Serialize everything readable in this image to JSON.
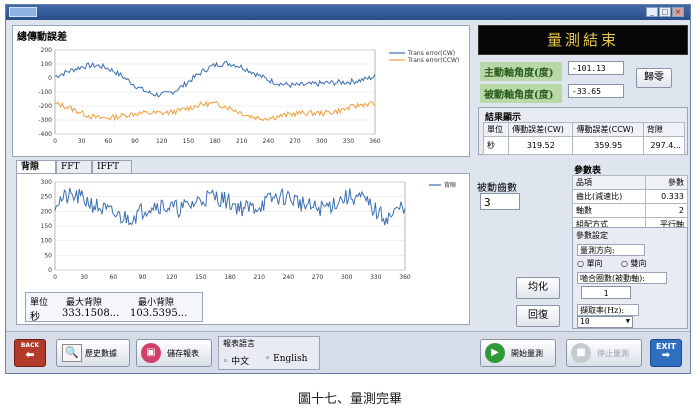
{
  "window": {
    "min": "_",
    "max": "□",
    "close": "×"
  },
  "top_chart": {
    "title": "總傳動誤差",
    "legend": [
      "Trans error(CW)",
      "Trans error(CCW)"
    ],
    "yticks": [
      "200",
      "100",
      "0",
      "-100",
      "-200",
      "-300",
      "-400"
    ],
    "xticks": [
      "0",
      "30",
      "60",
      "90",
      "120",
      "150",
      "180",
      "210",
      "240",
      "270",
      "300",
      "330",
      "360"
    ]
  },
  "result_header": "量測結束",
  "driving_angle": {
    "label": "主動軸角度(度)",
    "value": "-101.13"
  },
  "driven_angle": {
    "label": "被動軸角度(度)",
    "value": "-33.65"
  },
  "reset_button": "歸零",
  "results": {
    "title": "結果顯示",
    "headers": [
      "單位",
      "傳動誤差(CW)",
      "傳動誤差(CCW)",
      "背隙"
    ],
    "row": [
      "秒",
      "319.52",
      "359.95",
      "297.4..."
    ]
  },
  "tabs": [
    "背隙",
    "FFT",
    "IFFT"
  ],
  "backlash_chart": {
    "legend": "背隙",
    "yticks": [
      "300",
      "250",
      "200",
      "150",
      "100",
      "50",
      "0"
    ],
    "xticks": [
      "0",
      "30",
      "60",
      "90",
      "120",
      "150",
      "180",
      "210",
      "240",
      "270",
      "300",
      "330",
      "360"
    ]
  },
  "backlash_summary": {
    "headers": [
      "單位",
      "最大背隙",
      "最小背隙"
    ],
    "row": [
      "秒",
      "333.1508...",
      "103.5395..."
    ]
  },
  "teeth": {
    "label": "被動齒數",
    "value": "3"
  },
  "average_button": "均化",
  "restore_button": "回復",
  "params": {
    "title": "參數表",
    "headers": [
      "品項",
      "參數"
    ],
    "rows": [
      [
        "齒比(減速比)",
        "0.333"
      ],
      [
        "軸數",
        "2"
      ],
      [
        "組配方式",
        "平行軸"
      ]
    ]
  },
  "settings": {
    "title": "參數設定",
    "direction_label": "量測方向:",
    "direction_options": [
      "單向",
      "雙向"
    ],
    "mesh_label": "嚙合圈數(被動軸):",
    "mesh_value": "1",
    "rate_label": "擷取率(Hz):",
    "rate_value": "10"
  },
  "bottom": {
    "back": "BACK",
    "history": "歷史數據",
    "save": "儲存報表",
    "lang_title": "報表語言",
    "lang_options": [
      "中文",
      "English"
    ],
    "start": "開始量測",
    "stop": "停止量測",
    "exit": "EXIT"
  },
  "figure_caption": "圖十七、量測完畢",
  "colors": {
    "cw": "#3d6fb0",
    "ccw": "#f0a040",
    "backlash": "#3d6fb0"
  }
}
